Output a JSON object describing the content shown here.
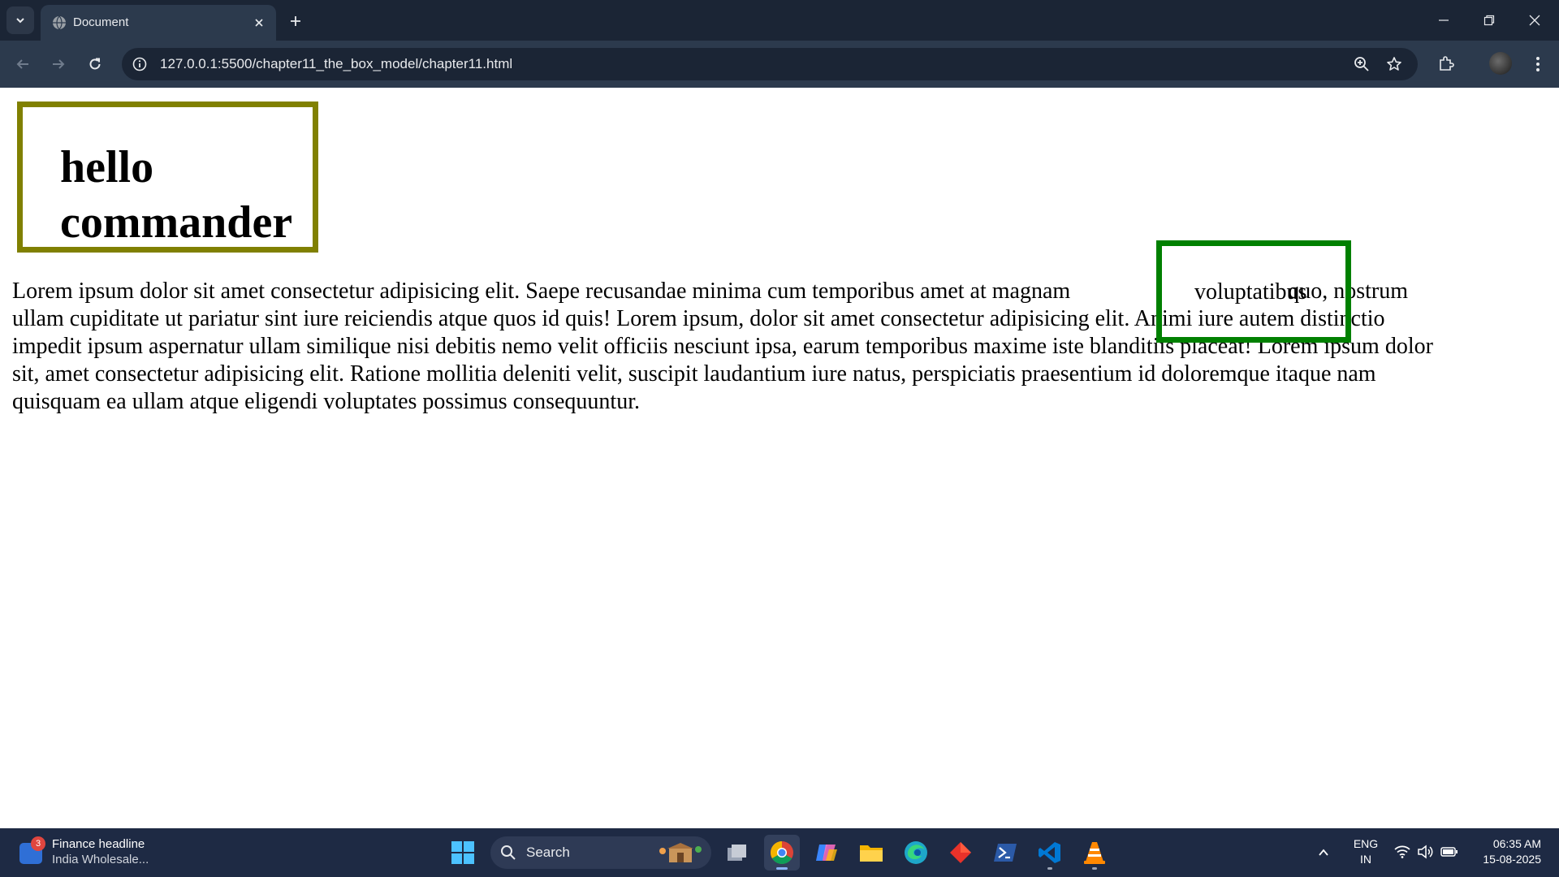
{
  "browser": {
    "tab_title": "Document",
    "url": "127.0.0.1:5500/chapter11_the_box_model/chapter11.html"
  },
  "page": {
    "heading_line1": "hello",
    "heading_line2": "commander",
    "paragraph_lines": [
      "Lorem ipsum dolor sit amet consectetur adipisicing elit. Saepe recusandae minima cum temporibus amet at magnam",
      "ullam cupiditate ut pariatur sint iure reiciendis atque quos id quis! Lorem ipsum, dolor sit amet consectetur adipisicing elit. Animi iure autem distinctio",
      "impedit ipsum aspernatur ullam similique nisi debitis nemo velit officiis nesciunt ipsa, earum temporibus maxime iste blanditiis placeat! Lorem ipsum dolor",
      "sit, amet consectetur adipisicing elit. Ratione mollitia deleniti velit, suscipit laudantium iure natus, perspiciatis praesentium id doloremque itaque nam",
      "quisquam ea ullam atque eligendi voluptates possimus consequuntur."
    ],
    "line1_tail": "quo, nostrum",
    "span_word": "voluptatibus",
    "heading_border_color": "#808000",
    "span_border_color": "#008000"
  },
  "taskbar": {
    "widget_badge": "3",
    "widget_title": "Finance headline",
    "widget_subtitle": "India Wholesale...",
    "search_label": "Search",
    "language_line1": "ENG",
    "language_line2": "IN",
    "time": "06:35 AM",
    "date": "15-08-2025",
    "apps": [
      "file-explorer-icon",
      "task-view-icon",
      "chrome-icon",
      "copilot-icon",
      "folder-icon",
      "edge-icon",
      "git-icon",
      "powershell-icon",
      "vscode-icon",
      "vlc-icon"
    ]
  }
}
